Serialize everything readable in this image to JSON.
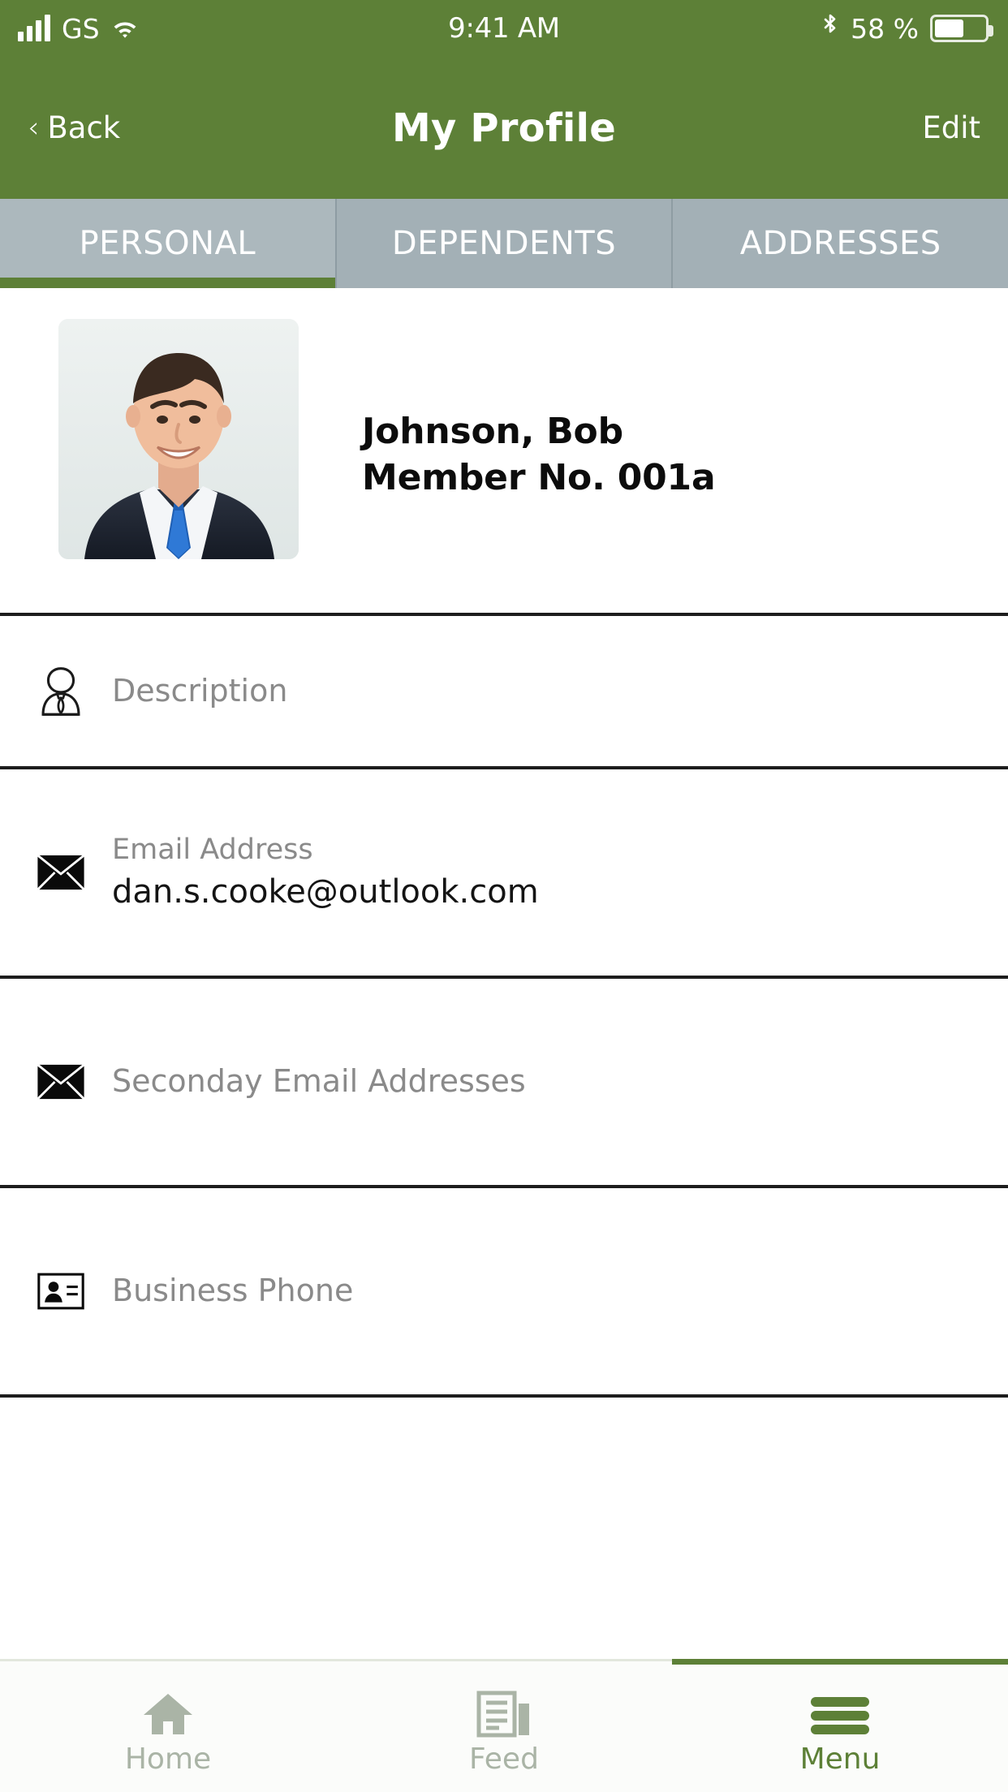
{
  "status_bar": {
    "carrier": "GS",
    "time": "9:41 AM",
    "battery_percent": "58 %",
    "signal_icon": "signal-bars-icon",
    "wifi_icon": "wifi-icon",
    "bluetooth_icon": "bluetooth-icon",
    "battery_icon": "battery-icon"
  },
  "nav_bar": {
    "back_label": "Back",
    "back_chevron": "‹",
    "title": "My Profile",
    "edit_label": "Edit"
  },
  "tabs": [
    {
      "label": "PERSONAL",
      "active": true
    },
    {
      "label": "DEPENDENTS",
      "active": false
    },
    {
      "label": "ADDRESSES",
      "active": false
    }
  ],
  "profile": {
    "avatar_alt": "profile-photo",
    "name": "Johnson, Bob",
    "member_no": "Member No. 001a"
  },
  "fields": [
    {
      "icon": "person-tie-icon",
      "label": "Description",
      "value": "",
      "is_placeholder": true
    },
    {
      "icon": "envelope-icon",
      "label": "Email Address",
      "value": "dan.s.cooke@outlook.com",
      "is_placeholder": false
    },
    {
      "icon": "envelope-icon",
      "label": "Seconday Email Addresses",
      "value": "",
      "is_placeholder": true
    },
    {
      "icon": "contact-card-icon",
      "label": "Business Phone",
      "value": "",
      "is_placeholder": true
    }
  ],
  "bottom_nav": [
    {
      "label": "Home",
      "icon": "home-icon",
      "active": false
    },
    {
      "label": "Feed",
      "icon": "feed-icon",
      "active": false
    },
    {
      "label": "Menu",
      "icon": "hamburger-icon",
      "active": true
    }
  ],
  "colors": {
    "brand_green": "#5d8037",
    "tab_gray": "#a3b0b6",
    "muted_text": "#8a8a8a"
  }
}
